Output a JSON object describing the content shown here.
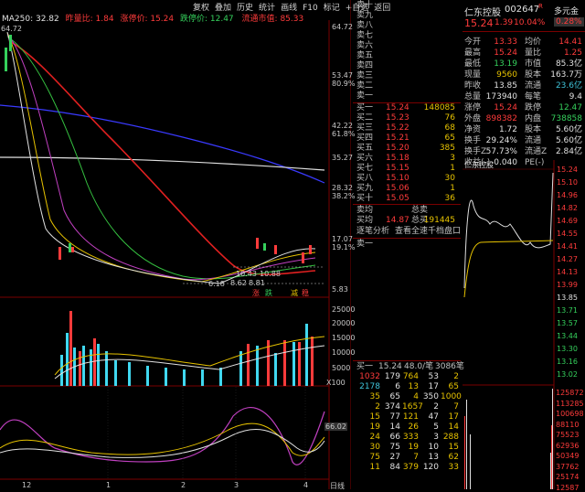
{
  "toolbar": [
    "复权",
    "叠加",
    "历史",
    "统计",
    "画线",
    "F10",
    "标记",
    "+自选",
    "返回"
  ],
  "main_info": {
    "ma": "MA250: 32.82",
    "vol_label": "昨量比: 1.84",
    "price_label": "涨停价: 15.24",
    "limit_down_label": "跌停价: 12.47",
    "cap_label": "流通市值: 85.33"
  },
  "price_axis": [
    "64.72",
    "53.47",
    "80.9%",
    "42.22",
    "61.8%",
    "35.27",
    "28.32",
    "38.2%",
    "17.07",
    "19.1%",
    "5.83"
  ],
  "price_ticks_hi": "64.72",
  "chart_annotations": [
    "10.43",
    "10.88",
    "6.18",
    "8.62",
    "8.81",
    "涨",
    "跌",
    "减",
    "稳"
  ],
  "volume_axis": [
    "25000",
    "20000",
    "15000",
    "10000",
    "5000",
    "X100"
  ],
  "osc_axis": [
    "66.02"
  ],
  "x_axis": [
    "12",
    "1",
    "2",
    "3",
    "4",
    "日线"
  ],
  "stock": {
    "name": "仁东控股",
    "code": "002647",
    "flag": "R",
    "price": "15.24",
    "change": "1.39",
    "pct": "10.04%",
    "more": "多元金融",
    "more_pct": "0.28%"
  },
  "sell_book": [
    {
      "label": "卖十",
      "price": "",
      "vol": ""
    },
    {
      "label": "卖九",
      "price": "",
      "vol": ""
    },
    {
      "label": "卖八",
      "price": "",
      "vol": ""
    },
    {
      "label": "卖七",
      "price": "",
      "vol": ""
    },
    {
      "label": "卖六",
      "price": "",
      "vol": ""
    },
    {
      "label": "卖五",
      "price": "",
      "vol": ""
    },
    {
      "label": "卖四",
      "price": "",
      "vol": ""
    },
    {
      "label": "卖三",
      "price": "",
      "vol": ""
    },
    {
      "label": "卖二",
      "price": "",
      "vol": ""
    },
    {
      "label": "卖一",
      "price": "",
      "vol": ""
    }
  ],
  "buy_book": [
    {
      "label": "买一",
      "price": "15.24",
      "vol": "148085"
    },
    {
      "label": "买二",
      "price": "15.23",
      "vol": "76"
    },
    {
      "label": "买三",
      "price": "15.22",
      "vol": "68"
    },
    {
      "label": "买四",
      "price": "15.21",
      "vol": "65"
    },
    {
      "label": "买五",
      "price": "15.20",
      "vol": "385"
    },
    {
      "label": "买六",
      "price": "15.18",
      "vol": "3"
    },
    {
      "label": "买七",
      "price": "15.15",
      "vol": "1"
    },
    {
      "label": "买八",
      "price": "15.10",
      "vol": "30"
    },
    {
      "label": "买九",
      "price": "15.06",
      "vol": "1"
    },
    {
      "label": "买十",
      "price": "15.05",
      "vol": "36"
    }
  ],
  "book_summary": {
    "sell_avg_label": "卖均",
    "sell_total_label": "总卖",
    "buy_avg_label": "买均",
    "buy_avg": "14.87",
    "buy_total_label": "总买",
    "buy_total": "191445",
    "link1": "逐笔分析",
    "link2": "查看全速千档盘口"
  },
  "sell1_label": "卖一",
  "trades_header": {
    "label": "买一",
    "price": "15.24",
    "hands": "48.0/笔",
    "total": "3086笔"
  },
  "trades": [
    [
      "1032",
      "179",
      "764",
      "53",
      "2"
    ],
    [
      "2178",
      "6",
      "13",
      "17",
      "65"
    ],
    [
      "35",
      "65",
      "4",
      "350",
      "1000"
    ],
    [
      "2",
      "374",
      "1657",
      "2",
      "7"
    ],
    [
      "15",
      "77",
      "121",
      "47",
      "17"
    ],
    [
      "19",
      "14",
      "26",
      "5",
      "14"
    ],
    [
      "24",
      "66",
      "333",
      "3",
      "288"
    ],
    [
      "30",
      "75",
      "19",
      "10",
      "15"
    ],
    [
      "75",
      "27",
      "7",
      "13",
      "62"
    ],
    [
      "11",
      "84",
      "379",
      "120",
      "33"
    ]
  ],
  "quote_rows": [
    {
      "k1": "今开",
      "v1": "13.33",
      "k2": "均价",
      "v2": "14.41"
    },
    {
      "k1": "最高",
      "v1": "15.24",
      "k2": "量比",
      "v2": "1.25"
    },
    {
      "k1": "最低",
      "v1": "13.19",
      "k2": "市值",
      "v2": "85.3亿"
    },
    {
      "k1": "现量",
      "v1": "9560",
      "k2": "股本",
      "v2": "163.7万"
    },
    {
      "k1": "昨收",
      "v1": "13.85",
      "k2": "流通",
      "v2": "23.6亿"
    },
    {
      "k1": "总量",
      "v1": "173940",
      "k2": "每笔",
      "v2": "9.4"
    },
    {
      "k1": "涨停",
      "v1": "15.24",
      "k2": "跌停",
      "v2": "12.47"
    },
    {
      "k1": "外盘",
      "v1": "898382",
      "k2": "内盘",
      "v2": "738858"
    },
    {
      "k1": "净资",
      "v1": "1.72",
      "k2": "股本",
      "v2": "5.60亿"
    },
    {
      "k1": "换手",
      "v1": "29.24%",
      "k2": "流通",
      "v2": "5.60亿"
    },
    {
      "k1": "换手Z",
      "v1": "57.73%",
      "k2": "流通Z",
      "v2": "2.84亿"
    },
    {
      "k1": "收益(-)",
      "v1": "-0.040",
      "k2": "PE(-)",
      "v2": ""
    }
  ],
  "minute_title": "仁东控股",
  "minute_axis": [
    "15.24",
    "15.10",
    "14.96",
    "14.82",
    "14.69",
    "14.55",
    "14.41",
    "14.27",
    "14.13",
    "13.99",
    "13.85",
    "13.71",
    "13.57",
    "13.44",
    "13.30",
    "13.16",
    "13.02"
  ],
  "minute_vol_axis": [
    "125872",
    "113285",
    "100698",
    "88110",
    "75523",
    "62936",
    "50349",
    "37762",
    "25174",
    "12587"
  ],
  "colors": {
    "up": "#ff3b3b",
    "down": "#35d05c",
    "ma_yellow": "#e6c200",
    "ma_white": "#e0e0e0",
    "ma_red": "#e02020",
    "ma_blue": "#3a3aff",
    "bar_cyan": "#40d8f0",
    "purple": "#c040c0"
  }
}
